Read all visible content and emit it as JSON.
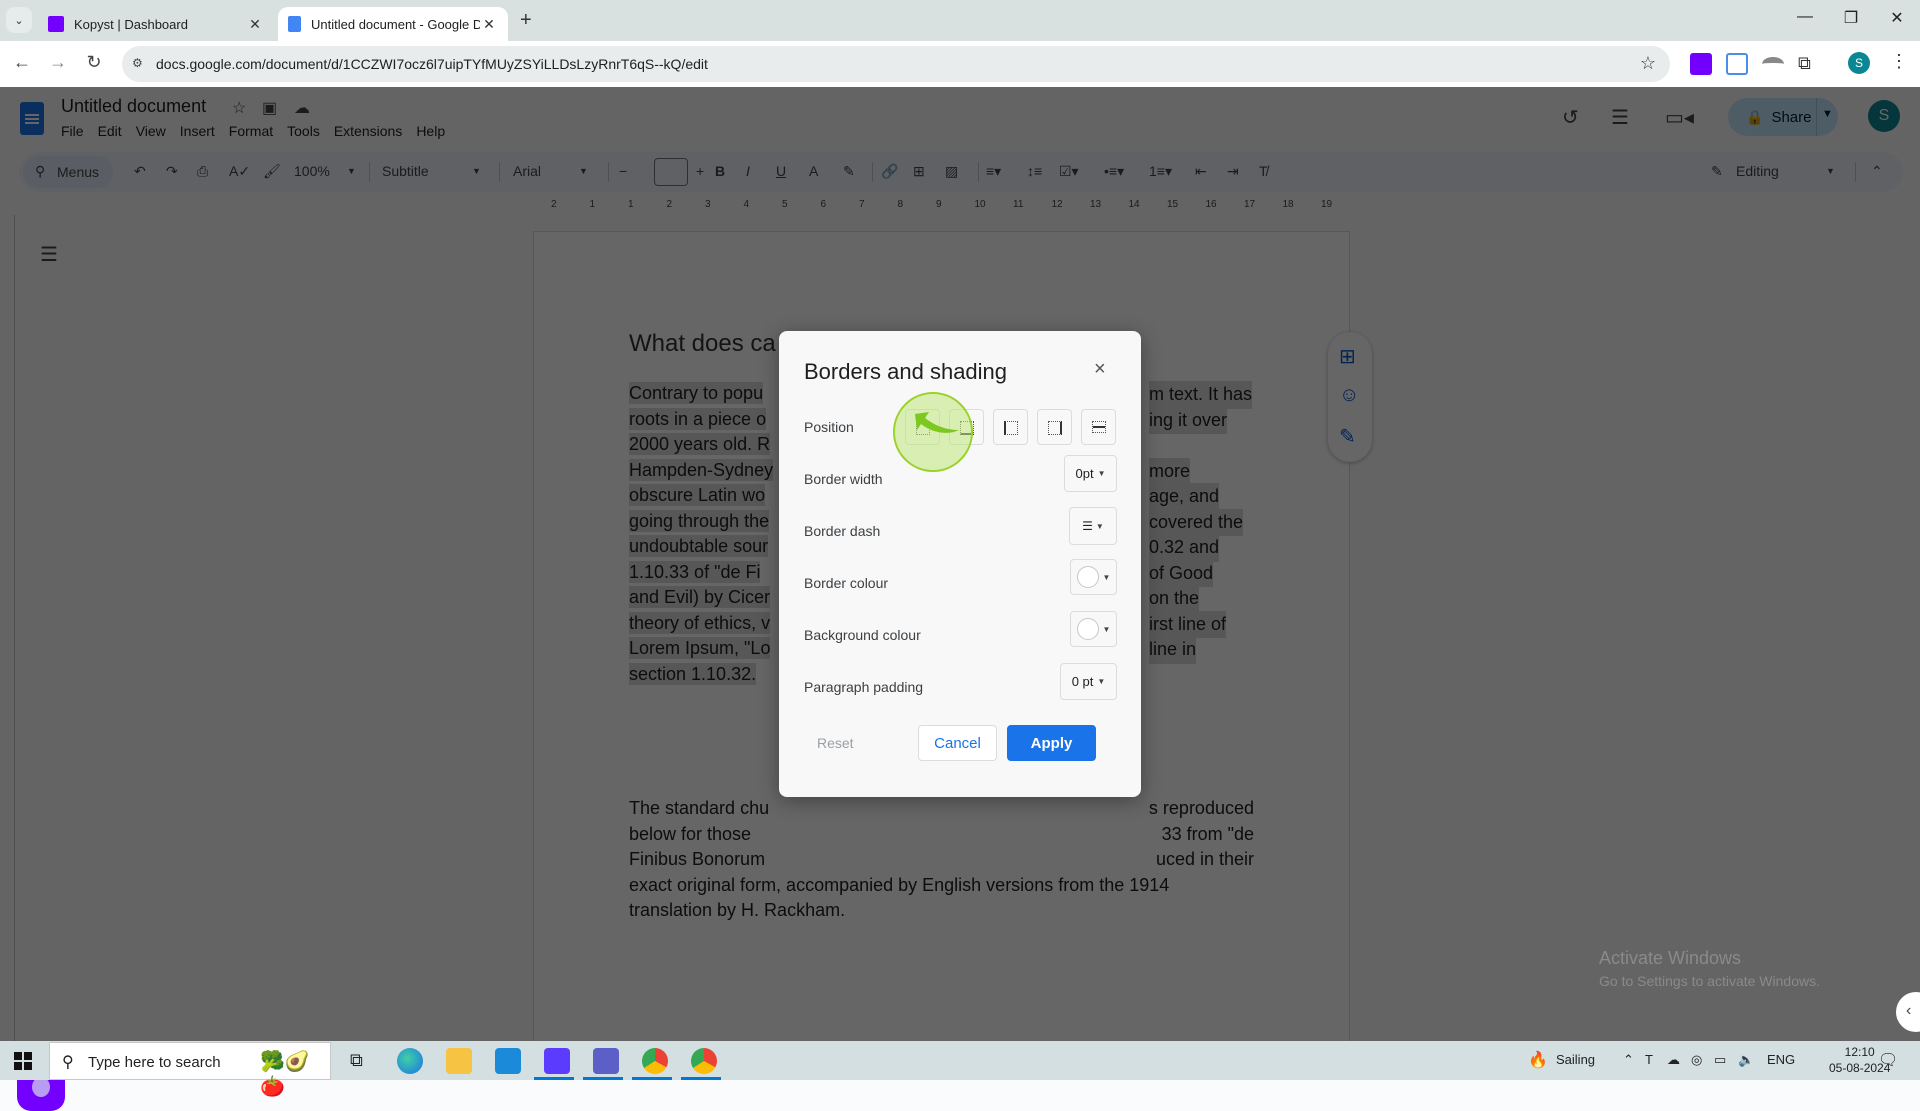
{
  "browser": {
    "tabs": [
      {
        "title": "Kopyst | Dashboard",
        "active": false
      },
      {
        "title": "Untitled document - Google Do",
        "active": true
      }
    ],
    "new_tab_label": "+",
    "url": "docs.google.com/document/d/1CCZWI7ocz6l7uipTYfMUyZSYiLLDsLzyRnrT6qS--kQ/edit",
    "profile_initial": "S",
    "window_controls": {
      "minimize": "—",
      "restore": "❐",
      "close": "✕"
    }
  },
  "docs": {
    "title": "Untitled document",
    "menu": [
      "File",
      "Edit",
      "View",
      "Insert",
      "Format",
      "Tools",
      "Extensions",
      "Help"
    ],
    "share_label": "Share",
    "avatar_initial": "S",
    "toolbar": {
      "search_label": "Menus",
      "zoom": "100%",
      "style": "Subtitle",
      "font": "Arial",
      "font_size": "",
      "mode": "Editing"
    },
    "ruler_ticks": [
      "2",
      "1",
      "1",
      "2",
      "3",
      "4",
      "5",
      "6",
      "7",
      "8",
      "9",
      "10",
      "11",
      "12",
      "13",
      "14",
      "15",
      "16",
      "17",
      "18",
      "19"
    ],
    "document": {
      "heading": "What does ca",
      "para1_lines": [
        " Contrary to popu",
        "roots in a piece o",
        "2000 years old. R",
        "Hampden-Sydney",
        "obscure Latin wo",
        "going through the",
        "undoubtable sour",
        "1.10.33 of \"de Fi",
        "and Evil) by Cicer",
        "theory of ethics, v",
        "Lorem Ipsum, \"Lo",
        "section 1.10.32."
      ],
      "para1_right_lines": [
        "m text. It has",
        "ing it over",
        "",
        "more",
        "age, and",
        "covered the",
        "0.32 and",
        "of Good",
        "on the",
        "irst line of",
        "line in",
        ""
      ],
      "para2_left": [
        "The standard chu",
        "below for those",
        "Finibus Bonorum",
        "exact original form, accompanied by English versions from the 1914",
        "translation by H. Rackham."
      ],
      "para2_right": [
        "s reproduced",
        "33 from \"de",
        "uced in their"
      ]
    }
  },
  "dialog": {
    "title": "Borders and shading",
    "close_label": "×",
    "position_label": "Position",
    "position_options": [
      "top",
      "bottom",
      "left",
      "right",
      "between"
    ],
    "border_width_label": "Border width",
    "border_width_value": "0pt",
    "border_dash_label": "Border dash",
    "border_colour_label": "Border colour",
    "background_colour_label": "Background colour",
    "paragraph_padding_label": "Paragraph padding",
    "paragraph_padding_value": "0 pt",
    "reset_label": "Reset",
    "cancel_label": "Cancel",
    "apply_label": "Apply"
  },
  "watermark": {
    "line1": "Activate Windows",
    "line2": "Go to Settings to activate Windows."
  },
  "taskbar": {
    "search_placeholder": "Type here to search",
    "weather": "Sailing",
    "language": "ENG",
    "time": "12:10",
    "date": "05-08-2024"
  },
  "colors": {
    "accent": "#1a73e8",
    "share_bg": "#c2e7ff",
    "kopyst": "#7300ff",
    "click_highlight": "#9ad22a"
  }
}
